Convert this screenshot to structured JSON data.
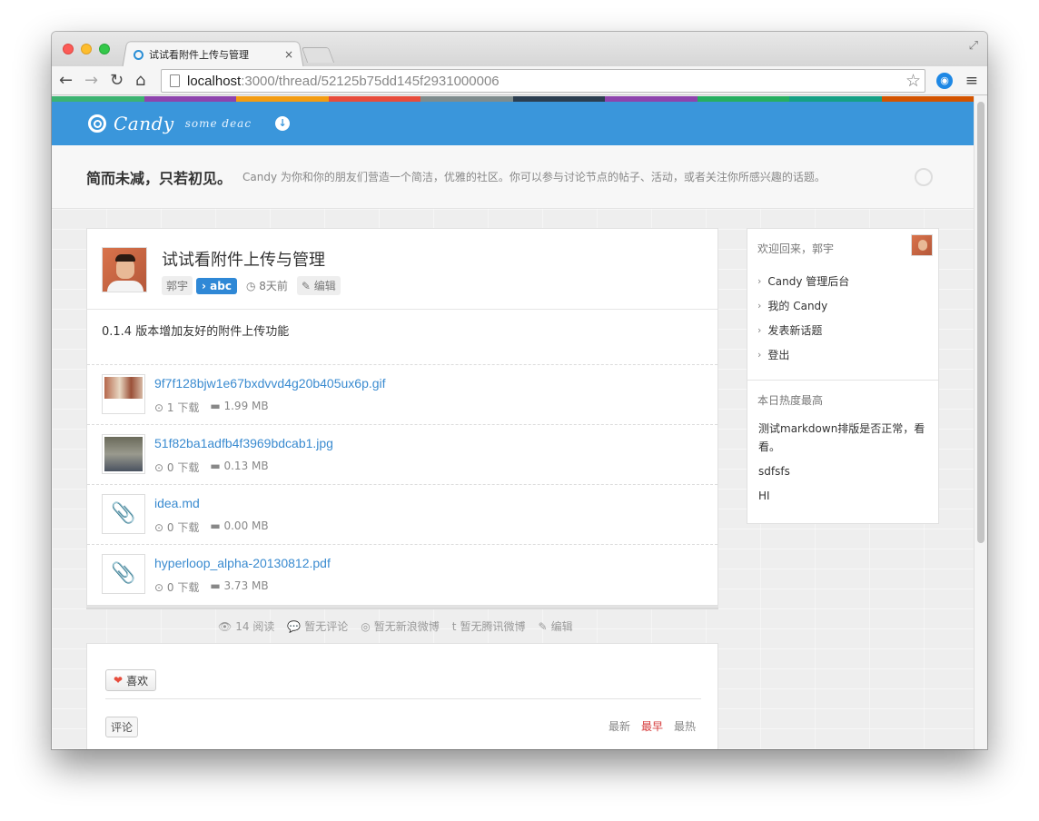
{
  "browser": {
    "tab_title": "试试看附件上传与管理",
    "tab_close": "×",
    "url_host": "localhost",
    "url_path": ":3000/thread/52125b75dd145f2931000006",
    "icons": [
      "back-icon",
      "forward-icon",
      "reload-icon",
      "home-icon",
      "star-icon",
      "menu-icon"
    ]
  },
  "site": {
    "colorbar": [
      "#3cb371",
      "#8e44ad",
      "#f39c12",
      "#e74c3c",
      "#7f8c8d",
      "#2c3e50",
      "#8e44ad",
      "#27ae60",
      "#16a085",
      "#d35400"
    ],
    "logo_text": "Candy",
    "logo_sub": "some deac",
    "header_color": "#3a96db"
  },
  "hero": {
    "title": "简而未减，只若初见。",
    "description": "Candy 为你和你的朋友们营造一个简洁，优雅的社区。你可以参与讨论节点的帖子、活动，或者关注你所感兴趣的话题。"
  },
  "post": {
    "title": "试试看附件上传与管理",
    "author": "郭宇",
    "node": "abc",
    "time": "8天前",
    "edit": "编辑",
    "body": "0.1.4 版本增加友好的附件上传功能",
    "attachments": [
      {
        "name": "9f7f128bjw1e67bxdvvd4g20b405ux6p.gif",
        "downloads": "1 下载",
        "size": "1.99 MB"
      },
      {
        "name": "51f82ba1adfb4f3969bdcab1.jpg",
        "downloads": "0 下载",
        "size": "0.13 MB"
      },
      {
        "name": "idea.md",
        "downloads": "0 下载",
        "size": "0.00 MB"
      },
      {
        "name": "hyperloop_alpha-20130812.pdf",
        "downloads": "0 下载",
        "size": "3.73 MB"
      }
    ]
  },
  "stats": {
    "views": "14 阅读",
    "comments": "暂无评论",
    "weibo": "暂无新浪微博",
    "tencent": "暂无腾讯微博",
    "edit": "编辑"
  },
  "comments": {
    "like": "喜欢",
    "tab": "评论",
    "sort": [
      "最新",
      "最早",
      "最热"
    ]
  },
  "sidebar": {
    "welcome": "欢迎回来，郭宇",
    "links": [
      "Candy 管理后台",
      "我的 Candy",
      "发表新话题",
      "登出"
    ],
    "hot_title": "本日热度最高",
    "hot": [
      "测试markdown排版是否正常，看看。",
      "sdfsfs",
      "HI"
    ]
  }
}
